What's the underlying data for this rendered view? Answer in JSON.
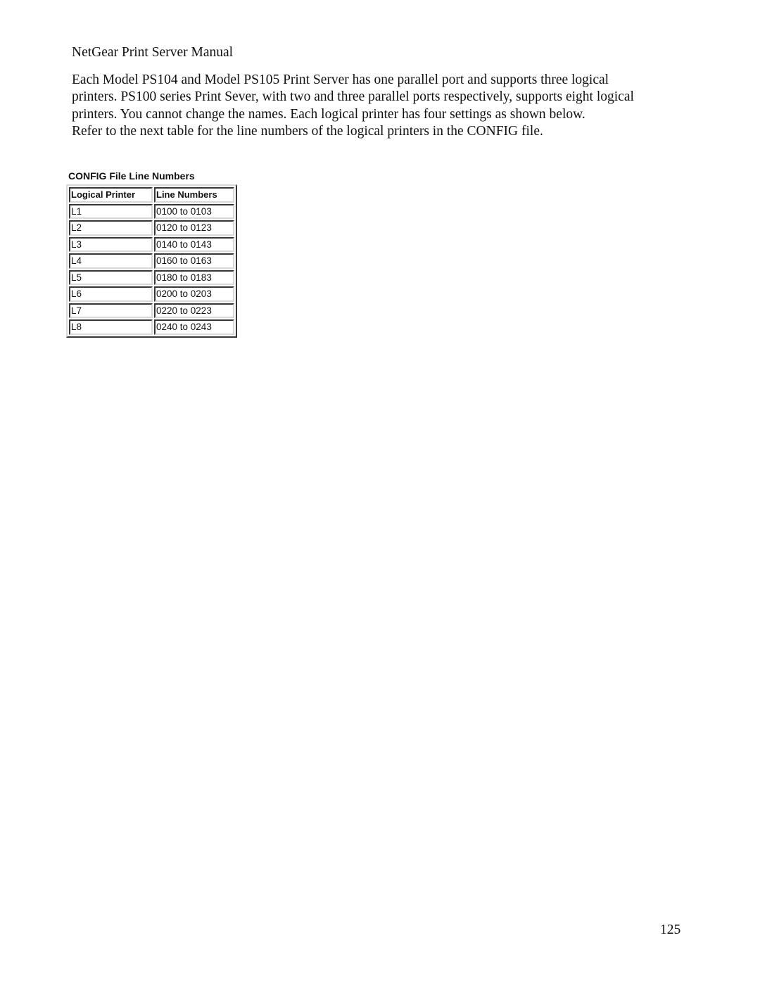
{
  "header": {
    "title": "NetGear Print Server Manual"
  },
  "body": {
    "lines": [
      "Each Model PS104 and Model PS105 Print Server has one parallel port and supports three logical",
      "printers. PS100 series Print Sever, with two and three parallel ports respectively, supports eight logical",
      "printers. You cannot change the names. Each logical printer has four settings as shown below.",
      "Refer to the next table for the line numbers of the logical printers in the CONFIG file."
    ]
  },
  "table": {
    "title": "CONFIG File Line Numbers",
    "columns": [
      "Logical Printer",
      "Line Numbers"
    ],
    "rows": [
      [
        "L1",
        "0100 to 0103"
      ],
      [
        "L2",
        "0120 to 0123"
      ],
      [
        "L3",
        "0140 to 0143"
      ],
      [
        "L4",
        "0160 to 0163"
      ],
      [
        "L5",
        "0180 to 0183"
      ],
      [
        "L6",
        "0200 to 0203"
      ],
      [
        "L7",
        "0220 to 0223"
      ],
      [
        "L8",
        "0240 to 0243"
      ]
    ]
  },
  "footer": {
    "page_number": "125"
  }
}
